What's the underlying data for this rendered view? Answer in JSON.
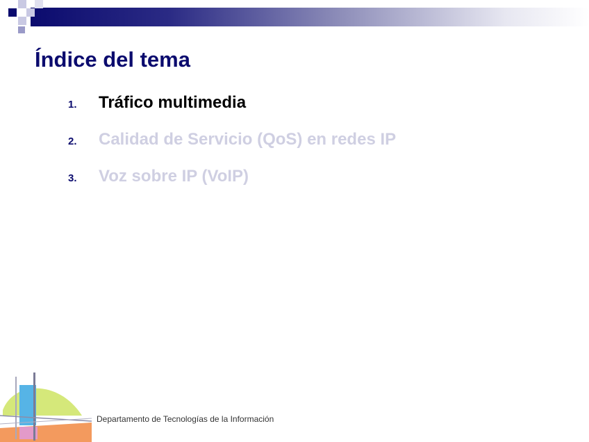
{
  "slide": {
    "title": "Índice del tema",
    "items": [
      {
        "number": "1.",
        "text": "Tráfico multimedia",
        "color": "#000000"
      },
      {
        "number": "2.",
        "text": "Calidad de Servicio (QoS) en redes IP",
        "color": "#cfcfe2"
      },
      {
        "number": "3.",
        "text": "Voz sobre IP (VoIP)",
        "color": "#cfcfe2"
      }
    ],
    "footer": "Departamento de Tecnologías de la Información"
  },
  "colors": {
    "title": "#0b0b6e",
    "active_item": "#000000",
    "inactive_item": "#cfcfe2",
    "banner_dark": "#0b0b6e"
  },
  "icons": {
    "header": "checker-square-decoration",
    "logo": "department-logo"
  }
}
